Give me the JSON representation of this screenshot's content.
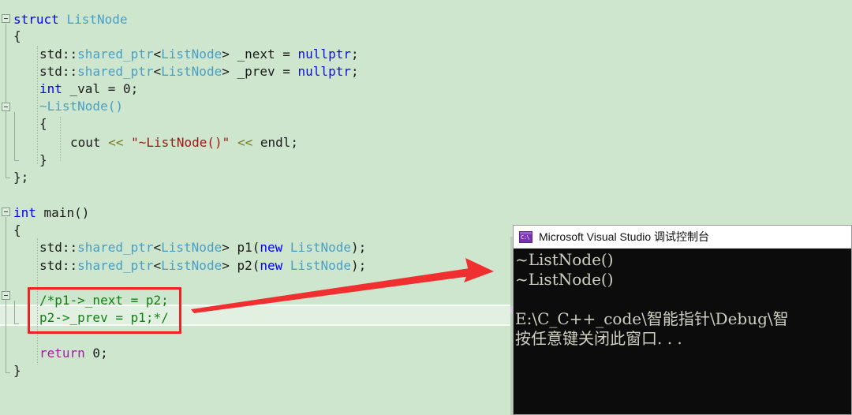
{
  "editor": {
    "background_color": "#cee6ce",
    "current_line_color": "#e2f0e2",
    "lines": [
      {
        "n": 1,
        "indent": 0,
        "text": "struct ListNode"
      },
      {
        "n": 2,
        "indent": 0,
        "text": "{"
      },
      {
        "n": 3,
        "indent": 1,
        "text": "std::shared_ptr<ListNode> _next = nullptr;"
      },
      {
        "n": 4,
        "indent": 1,
        "text": "std::shared_ptr<ListNode> _prev = nullptr;"
      },
      {
        "n": 5,
        "indent": 1,
        "text": "int _val = 0;"
      },
      {
        "n": 6,
        "indent": 1,
        "text": "~ListNode()"
      },
      {
        "n": 7,
        "indent": 1,
        "text": "{"
      },
      {
        "n": 8,
        "indent": 2,
        "text": "cout << \"~ListNode()\" << endl;"
      },
      {
        "n": 9,
        "indent": 1,
        "text": "}"
      },
      {
        "n": 10,
        "indent": 0,
        "text": "};"
      },
      {
        "n": 11,
        "indent": 0,
        "text": ""
      },
      {
        "n": 12,
        "indent": 0,
        "text": "int main()"
      },
      {
        "n": 13,
        "indent": 0,
        "text": "{"
      },
      {
        "n": 14,
        "indent": 1,
        "text": "std::shared_ptr<ListNode> p1(new ListNode);"
      },
      {
        "n": 15,
        "indent": 1,
        "text": "std::shared_ptr<ListNode> p2(new ListNode);"
      },
      {
        "n": 16,
        "indent": 1,
        "text": ""
      },
      {
        "n": 17,
        "indent": 1,
        "text": "/*p1->_next = p2;"
      },
      {
        "n": 18,
        "indent": 1,
        "text": "p2->_prev = p1;*/"
      },
      {
        "n": 19,
        "indent": 1,
        "text": ""
      },
      {
        "n": 20,
        "indent": 1,
        "text": "return 0;"
      },
      {
        "n": 21,
        "indent": 0,
        "text": "}"
      }
    ],
    "tokens": {
      "l1_kw": "struct",
      "l1_type": "ListNode",
      "l2": "{",
      "l3_a": "std::",
      "l3_type1": "shared_ptr",
      "l3_lt": "<",
      "l3_type2": "ListNode",
      "l3_gt": "> _next = ",
      "l3_lit": "nullptr",
      "l3_end": ";",
      "l4_a": "std::",
      "l4_type1": "shared_ptr",
      "l4_lt": "<",
      "l4_type2": "ListNode",
      "l4_gt": "> _prev = ",
      "l4_lit": "nullptr",
      "l4_end": ";",
      "l5_kw": "int",
      "l5_rest": " _val = 0;",
      "l6_dtor": "~ListNode()",
      "l7": "{",
      "l8_a": "cout ",
      "l8_op1": "<<",
      "l8_b": " ",
      "l8_str": "\"~ListNode()\"",
      "l8_c": " ",
      "l8_op2": "<<",
      "l8_d": " endl;",
      "l9": "}",
      "l10": "};",
      "l12_kw": "int",
      "l12_rest": " main()",
      "l13": "{",
      "l14_a": "std::",
      "l14_type1": "shared_ptr",
      "l14_lt": "<",
      "l14_type2": "ListNode",
      "l14_mid": "> p1(",
      "l14_kw": "new",
      "l14_sp": " ",
      "l14_type3": "ListNode",
      "l14_end": ");",
      "l15_a": "std::",
      "l15_type1": "shared_ptr",
      "l15_lt": "<",
      "l15_type2": "ListNode",
      "l15_mid": "> p2(",
      "l15_kw": "new",
      "l15_sp": " ",
      "l15_type3": "ListNode",
      "l15_end": ");",
      "l17_cmt": "/*p1->_next = p2;",
      "l18_cmt": "p2->_prev = p1;*/",
      "l20_ctl": "return",
      "l20_rest": " 0;",
      "l21": "}"
    }
  },
  "annotation": {
    "highlight_color": "#ee2222",
    "box_target_lines": "/*p1->_next = p2;  p2->_prev = p1;*/",
    "arrow_description": "red arrow from commented code to console output"
  },
  "console": {
    "title": "Microsoft Visual Studio 调试控制台",
    "icon": "console-window-icon",
    "icon_label": "C:\\",
    "background_color": "#0c0c0c",
    "text_color": "#cfcfc2",
    "lines": [
      "~ListNode()",
      "~ListNode()",
      "",
      "E:\\C_C++_code\\智能指针\\Debug\\智",
      "按任意键关闭此窗口. . ."
    ]
  }
}
